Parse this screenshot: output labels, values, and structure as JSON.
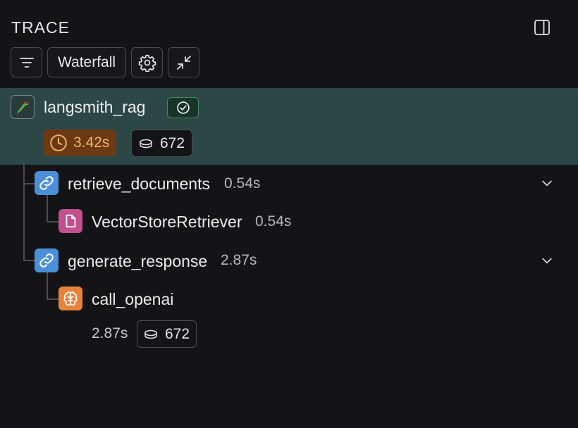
{
  "header": {
    "title": "TRACE"
  },
  "toolbar": {
    "view_label": "Waterfall"
  },
  "root": {
    "name": "langsmith_rag",
    "latency": "3.42s",
    "tokens": "672",
    "status": "success",
    "colors": {
      "row_bg": "#2d4746",
      "latency_bg": "#6b3a12",
      "latency_text": "#f3b36a",
      "status_border": "#3f8b5c"
    }
  },
  "nodes": [
    {
      "name": "retrieve_documents",
      "time": "0.54s",
      "icon": "chain-icon",
      "color": "#4a8fd8",
      "expanded": true
    },
    {
      "name": "VectorStoreRetriever",
      "time": "0.54s",
      "icon": "document-icon",
      "color": "#c2508e"
    },
    {
      "name": "generate_response",
      "time": "2.87s",
      "icon": "chain-icon",
      "color": "#4a8fd8",
      "expanded": true
    },
    {
      "name": "call_openai",
      "time": "2.87s",
      "tokens": "672",
      "icon": "brain-icon",
      "color": "#e8843a"
    }
  ]
}
